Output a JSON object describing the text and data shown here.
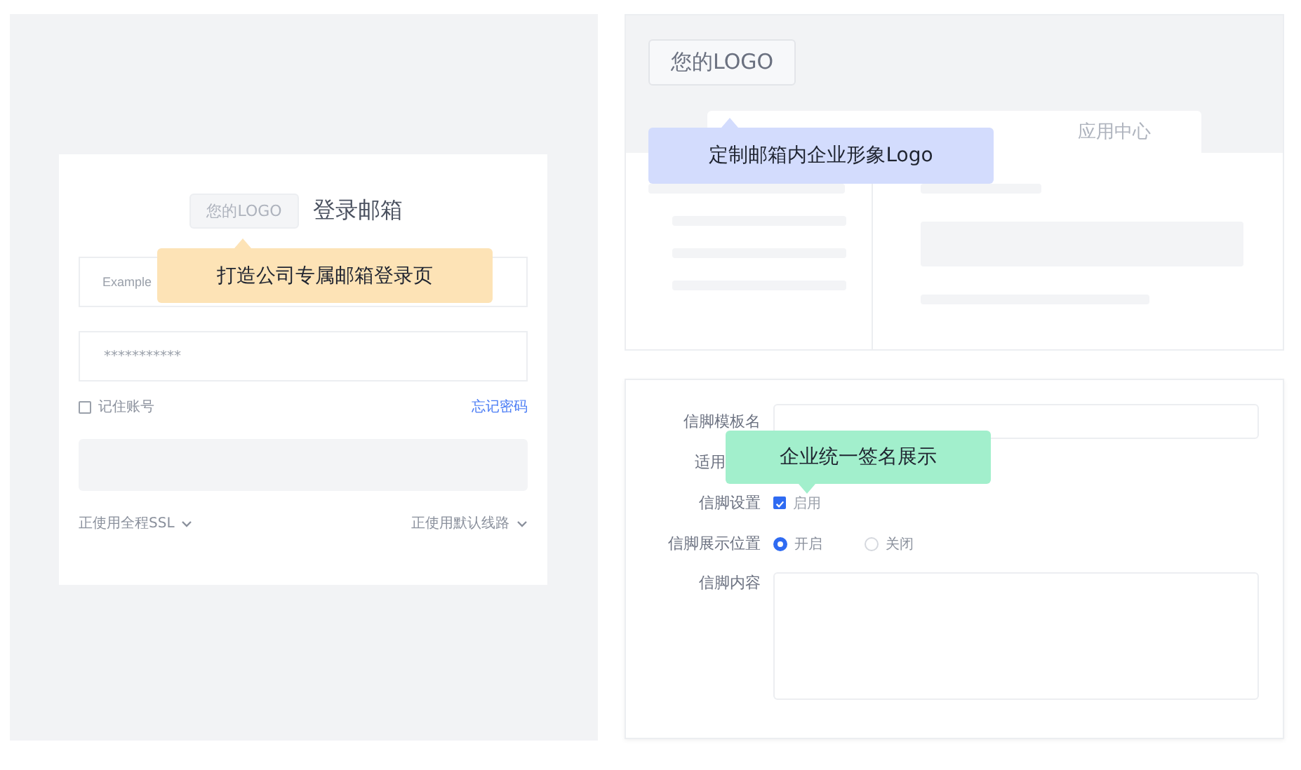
{
  "login_panel": {
    "logo": "您的LOGO",
    "title": "登录邮箱",
    "email_field": {
      "placeholder": "Example"
    },
    "password_field": {
      "value": "***********"
    },
    "remember": {
      "label": "记住账号",
      "checked": false
    },
    "forgot_link": "忘记密码",
    "ssl_select": "正使用全程SSL",
    "route_select": "正使用默认线路",
    "callout": "打造公司专属邮箱登录页"
  },
  "mailbox_preview": {
    "logo": "您的LOGO",
    "tabs": [
      {
        "label": "应用中心"
      }
    ],
    "callout": "定制邮箱内企业形象Logo"
  },
  "signature_form": {
    "rows": [
      {
        "kind": "text",
        "label": "信脚模板名"
      },
      {
        "kind": "blank",
        "label": "适用"
      },
      {
        "kind": "checkbox",
        "label": "信脚设置",
        "option": "启用",
        "checked": true
      },
      {
        "kind": "radio",
        "label": "信脚展示位置",
        "options": [
          {
            "label": "开启",
            "selected": true
          },
          {
            "label": "关闭",
            "selected": false
          }
        ]
      },
      {
        "kind": "textarea",
        "label": "信脚内容"
      }
    ],
    "callout": "企业统一签名展示"
  }
}
